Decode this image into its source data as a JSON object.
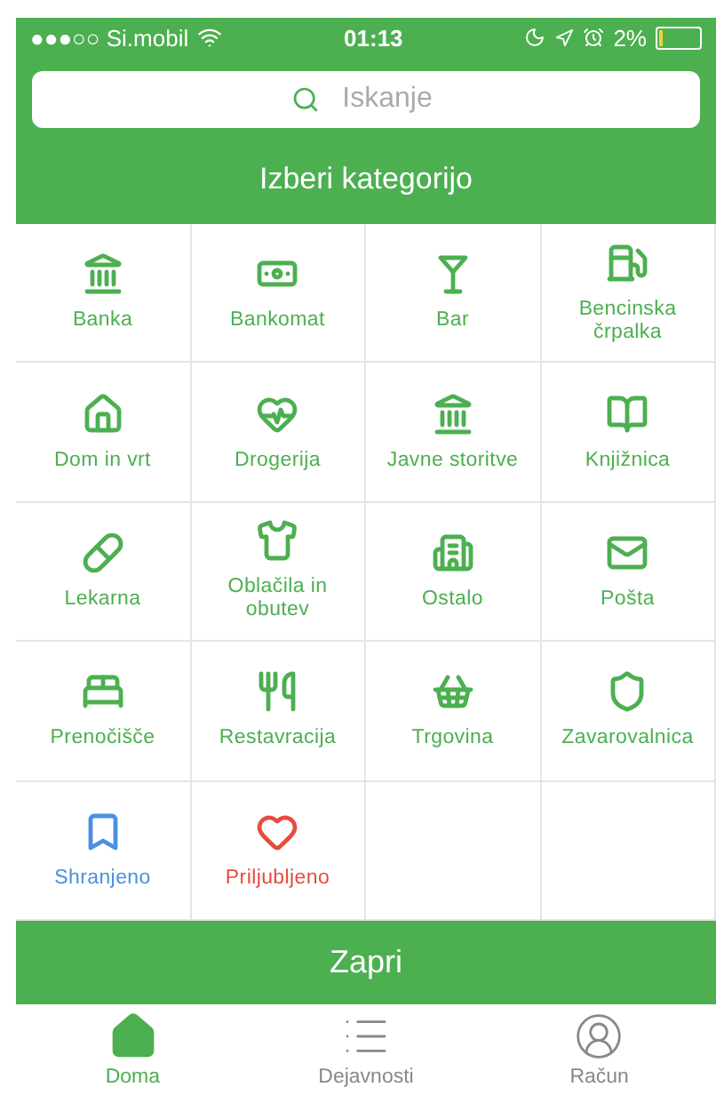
{
  "status_bar": {
    "carrier": "●●●○○ Si.mobil",
    "time": "01:13",
    "battery_percent": "2%"
  },
  "search": {
    "placeholder": "Iskanje"
  },
  "title": "Izberi kategorijo",
  "categories": [
    {
      "label": "Banka",
      "color": "#4caf50"
    },
    {
      "label": "Bankomat",
      "color": "#4caf50"
    },
    {
      "label": "Bar",
      "color": "#4caf50"
    },
    {
      "label": "Bencinska črpalka",
      "color": "#4caf50"
    },
    {
      "label": "Dom in vrt",
      "color": "#4caf50"
    },
    {
      "label": "Drogerija",
      "color": "#4caf50"
    },
    {
      "label": "Javne storitve",
      "color": "#4caf50"
    },
    {
      "label": "Knjižnica",
      "color": "#4caf50"
    },
    {
      "label": "Lekarna",
      "color": "#4caf50"
    },
    {
      "label": "Oblačila in obutev",
      "color": "#4caf50"
    },
    {
      "label": "Ostalo",
      "color": "#4caf50"
    },
    {
      "label": "Pošta",
      "color": "#4caf50"
    },
    {
      "label": "Prenočišče",
      "color": "#4caf50"
    },
    {
      "label": "Restavracija",
      "color": "#4caf50"
    },
    {
      "label": "Trgovina",
      "color": "#4caf50"
    },
    {
      "label": "Zavarovalnica",
      "color": "#4caf50"
    },
    {
      "label": "Shranjeno",
      "color": "#4a90e2"
    },
    {
      "label": "Priljubljeno",
      "color": "#e74c3c"
    }
  ],
  "close_button": "Zapri",
  "tab_bar": [
    {
      "label": "Doma",
      "selected": true
    },
    {
      "label": "Dejavnosti",
      "selected": false
    },
    {
      "label": "Račun",
      "selected": false
    }
  ]
}
